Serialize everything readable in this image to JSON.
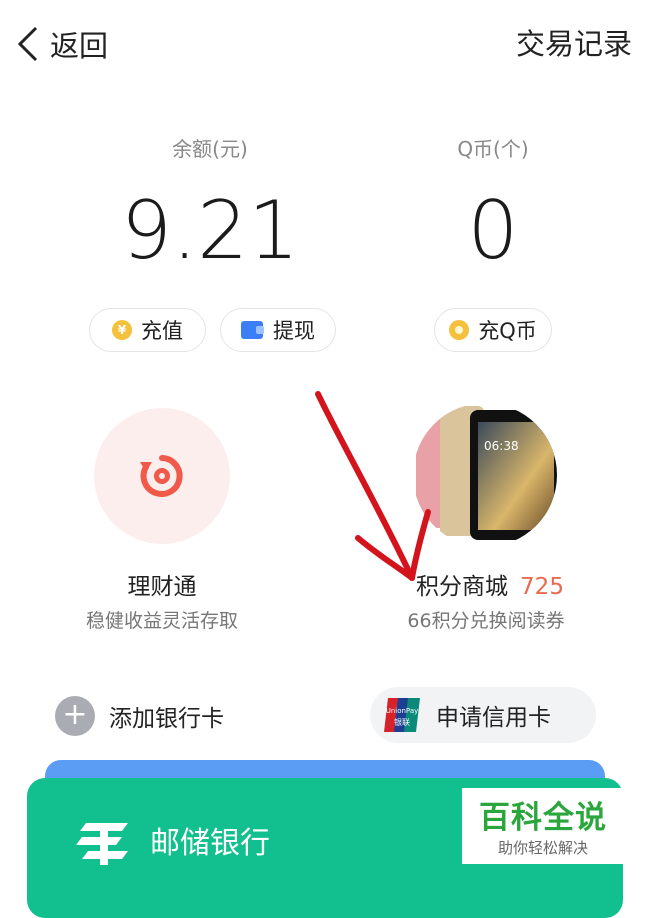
{
  "header": {
    "back_label": "返回",
    "records_label": "交易记录"
  },
  "balance": {
    "caption": "余额(元)",
    "value": "9.21",
    "recharge_label": "充值",
    "withdraw_label": "提现"
  },
  "qcoin": {
    "caption": "Q币(个)",
    "value": "0",
    "recharge_label": "充Q币"
  },
  "features": {
    "licaitong": {
      "title": "理财通",
      "subtitle": "稳健收益灵活存取"
    },
    "mall": {
      "title": "积分商城",
      "points": "725",
      "subtitle": "66积分兑换阅读券"
    }
  },
  "bank": {
    "add_card_label": "添加银行卡",
    "apply_credit_label": "申请信用卡",
    "unionpay_text": "UnionPay",
    "unionpay_cn": "银联"
  },
  "cards": [
    {
      "name": "邮储银行"
    }
  ],
  "watermark": {
    "title": "百科全说",
    "subtitle": "助你轻松解决"
  },
  "colors": {
    "accent_green": "#12bf8e",
    "accent_blue": "#5b9cf4",
    "points_red": "#e86a50",
    "coin_yellow": "#f5c13c"
  },
  "icons": [
    "chevron-left-icon",
    "yuan-coin-icon",
    "wallet-icon",
    "qcoin-icon",
    "licaitong-icon",
    "tablet-product-image",
    "plus-icon",
    "unionpay-icon",
    "postal-bank-logo"
  ]
}
